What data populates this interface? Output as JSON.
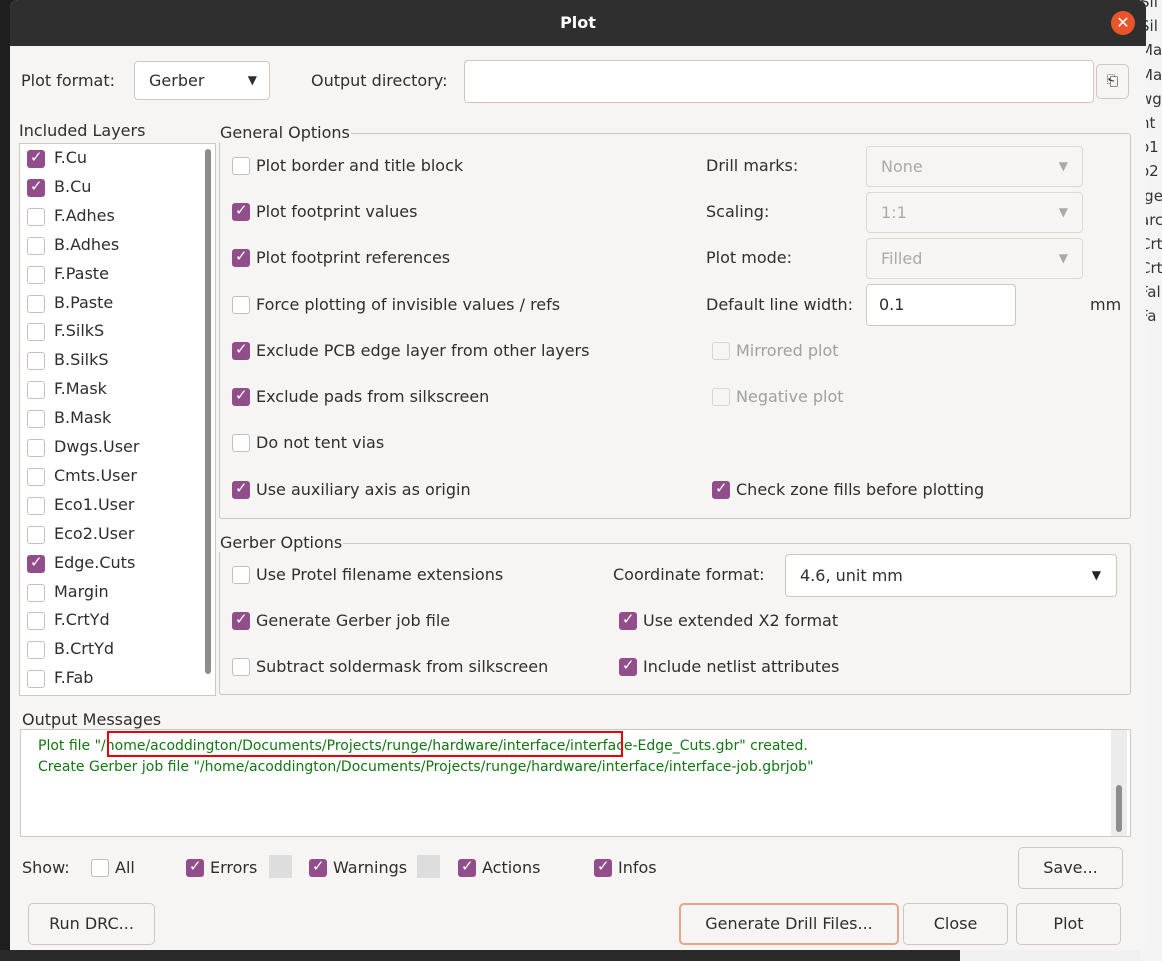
{
  "window": {
    "title": "Plot"
  },
  "background_text": [
    "Sil",
    "Sil",
    "Ma",
    "Ma",
    "wg",
    "nt",
    "o1",
    "o2",
    "lge",
    "arc",
    "Crt",
    "Crt",
    "Fal",
    "Fa"
  ],
  "top": {
    "plot_format_label": "Plot format:",
    "plot_format_value": "Gerber",
    "output_dir_label": "Output directory:",
    "output_dir_value": ""
  },
  "layers": {
    "title": "Included Layers",
    "items": [
      {
        "label": "F.Cu",
        "checked": true
      },
      {
        "label": "B.Cu",
        "checked": true
      },
      {
        "label": "F.Adhes",
        "checked": false
      },
      {
        "label": "B.Adhes",
        "checked": false
      },
      {
        "label": "F.Paste",
        "checked": false
      },
      {
        "label": "B.Paste",
        "checked": false
      },
      {
        "label": "F.SilkS",
        "checked": false
      },
      {
        "label": "B.SilkS",
        "checked": false
      },
      {
        "label": "F.Mask",
        "checked": false
      },
      {
        "label": "B.Mask",
        "checked": false
      },
      {
        "label": "Dwgs.User",
        "checked": false
      },
      {
        "label": "Cmts.User",
        "checked": false
      },
      {
        "label": "Eco1.User",
        "checked": false
      },
      {
        "label": "Eco2.User",
        "checked": false
      },
      {
        "label": "Edge.Cuts",
        "checked": true
      },
      {
        "label": "Margin",
        "checked": false
      },
      {
        "label": "F.CrtYd",
        "checked": false
      },
      {
        "label": "B.CrtYd",
        "checked": false
      },
      {
        "label": "F.Fab",
        "checked": false
      }
    ]
  },
  "general": {
    "title": "General Options",
    "plot_border": {
      "label": "Plot border and title block",
      "checked": false
    },
    "footprint_values": {
      "label": "Plot footprint values",
      "checked": true
    },
    "footprint_refs": {
      "label": "Plot footprint references",
      "checked": true
    },
    "force_invisible": {
      "label": "Force plotting of invisible values / refs",
      "checked": false
    },
    "exclude_edge": {
      "label": "Exclude PCB edge layer from other layers",
      "checked": true
    },
    "exclude_pads": {
      "label": "Exclude pads from silkscreen",
      "checked": true
    },
    "no_tent": {
      "label": "Do not tent vias",
      "checked": false
    },
    "aux_axis": {
      "label": "Use auxiliary axis as origin",
      "checked": true
    },
    "drill_marks_label": "Drill marks:",
    "drill_marks_value": "None",
    "scaling_label": "Scaling:",
    "scaling_value": "1:1",
    "plot_mode_label": "Plot mode:",
    "plot_mode_value": "Filled",
    "line_width_label": "Default line width:",
    "line_width_value": "0.1",
    "line_width_unit": "mm",
    "mirrored": {
      "label": "Mirrored plot",
      "checked": false
    },
    "negative": {
      "label": "Negative plot",
      "checked": false
    },
    "check_zone": {
      "label": "Check zone fills before plotting",
      "checked": true
    }
  },
  "gerber": {
    "title": "Gerber Options",
    "protel": {
      "label": "Use Protel filename extensions",
      "checked": false
    },
    "job_file": {
      "label": "Generate Gerber job file",
      "checked": true
    },
    "subtract_mask": {
      "label": "Subtract soldermask from silkscreen",
      "checked": false
    },
    "coord_label": "Coordinate format:",
    "coord_value": "4.6, unit mm",
    "x2": {
      "label": "Use extended X2 format",
      "checked": true
    },
    "netlist": {
      "label": "Include netlist attributes",
      "checked": true
    }
  },
  "messages": {
    "title": "Output Messages",
    "lines": [
      "Plot file \"/home/acoddington/Documents/Projects/runge/hardware/interface/interface-Edge_Cuts.gbr\" created.",
      "Create Gerber job file \"/home/acoddington/Documents/Projects/runge/hardware/interface/interface-job.gbrjob\""
    ]
  },
  "show": {
    "label": "Show:",
    "all": {
      "label": "All",
      "checked": false
    },
    "errors": {
      "label": "Errors",
      "checked": true
    },
    "warnings": {
      "label": "Warnings",
      "checked": true
    },
    "actions": {
      "label": "Actions",
      "checked": true
    },
    "infos": {
      "label": "Infos",
      "checked": true
    },
    "save_label": "Save..."
  },
  "buttons": {
    "run_drc": "Run DRC...",
    "generate_drill": "Generate Drill Files...",
    "close": "Close",
    "plot": "Plot"
  },
  "colors": {
    "accent": "#924d8b",
    "message_text": "#117711",
    "highlight": "#ee0000"
  }
}
